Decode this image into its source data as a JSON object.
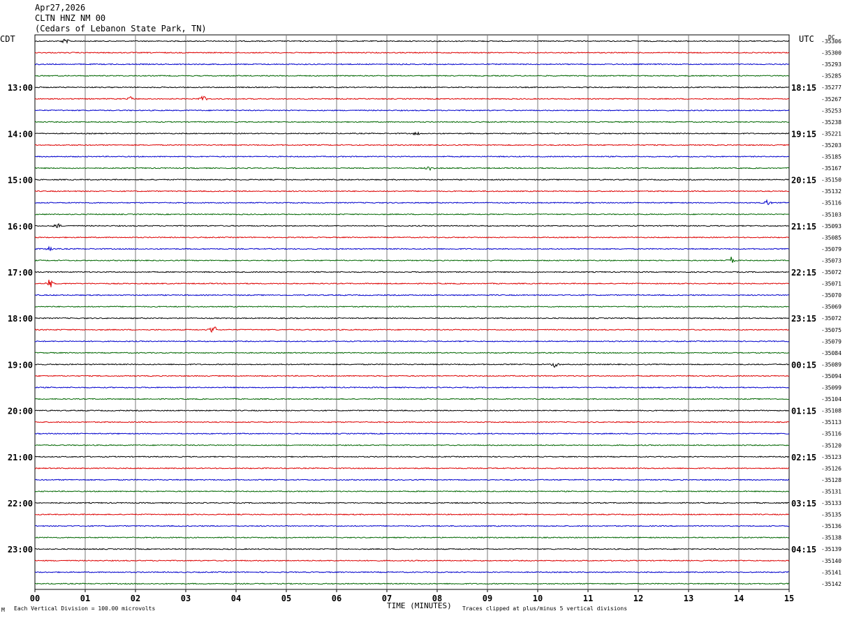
{
  "header": {
    "date": "Apr27,2026",
    "station": "CLTN HNZ NM 00",
    "location": "(Cedars of Lebanon State Park, TN)"
  },
  "labels": {
    "left_tz": "CDT",
    "right_tz": "UTC",
    "dc": "DC"
  },
  "footer": {
    "logo": "M",
    "scale": "Each Vertical Division =  100.00 microvolts",
    "xlabel": "TIME (MINUTES)",
    "clip": "Traces clipped at plus/minus 5 vertical divisions"
  },
  "chart_data": {
    "type": "line",
    "title": "",
    "xlabel": "TIME (MINUTES)",
    "xlim": [
      0,
      15
    ],
    "x_ticks": [
      "00",
      "01",
      "02",
      "03",
      "04",
      "05",
      "06",
      "07",
      "08",
      "09",
      "10",
      "11",
      "12",
      "13",
      "14",
      "15"
    ],
    "line_count": 48,
    "minutes_per_line": 15,
    "trace_colors": [
      "#000000",
      "#dd0000",
      "#0000cc",
      "#006600"
    ],
    "grid_color": "#7a7a7a",
    "left_hour_labels": [
      "13:00",
      "14:00",
      "15:00",
      "16:00",
      "17:00",
      "18:00",
      "19:00",
      "20:00",
      "21:00",
      "22:00",
      "23:00"
    ],
    "right_hour_labels": [
      "18:15",
      "19:15",
      "20:15",
      "21:15",
      "22:15",
      "23:15",
      "00:15",
      "01:15",
      "02:15",
      "03:15",
      "04:15"
    ],
    "dc_values": [
      "-35306",
      "-35300",
      "-35293",
      "-35285",
      "-35277",
      "-35267",
      "-35253",
      "-35238",
      "-35221",
      "-35203",
      "-35185",
      "-35167",
      "-35150",
      "-35132",
      "-35116",
      "-35103",
      "-35093",
      "-35085",
      "-35079",
      "-35073",
      "-35072",
      "-35071",
      "-35070",
      "-35069",
      "-35072",
      "-35075",
      "-35079",
      "-35084",
      "-35089",
      "-35094",
      "-35099",
      "-35104",
      "-35108",
      "-35113",
      "-35116",
      "-35120",
      "-35123",
      "-35126",
      "-35128",
      "-35131",
      "-35133",
      "-35135",
      "-35136",
      "-35138",
      "-35139",
      "-35140",
      "-35141",
      "-35142"
    ],
    "events": [
      {
        "line": 0,
        "minute": 0.6,
        "amp": 4
      },
      {
        "line": 5,
        "minute": 1.9,
        "amp": 3
      },
      {
        "line": 5,
        "minute": 3.35,
        "amp": 5
      },
      {
        "line": 8,
        "minute": 7.6,
        "amp": 3
      },
      {
        "line": 11,
        "minute": 7.85,
        "amp": 3
      },
      {
        "line": 14,
        "minute": 14.55,
        "amp": 4
      },
      {
        "line": 16,
        "minute": 0.45,
        "amp": 4
      },
      {
        "line": 18,
        "minute": 0.3,
        "amp": 3
      },
      {
        "line": 19,
        "minute": 13.85,
        "amp": 5
      },
      {
        "line": 21,
        "minute": 0.3,
        "amp": 6
      },
      {
        "line": 25,
        "minute": 3.55,
        "amp": 6
      },
      {
        "line": 28,
        "minute": 10.35,
        "amp": 5
      }
    ]
  }
}
